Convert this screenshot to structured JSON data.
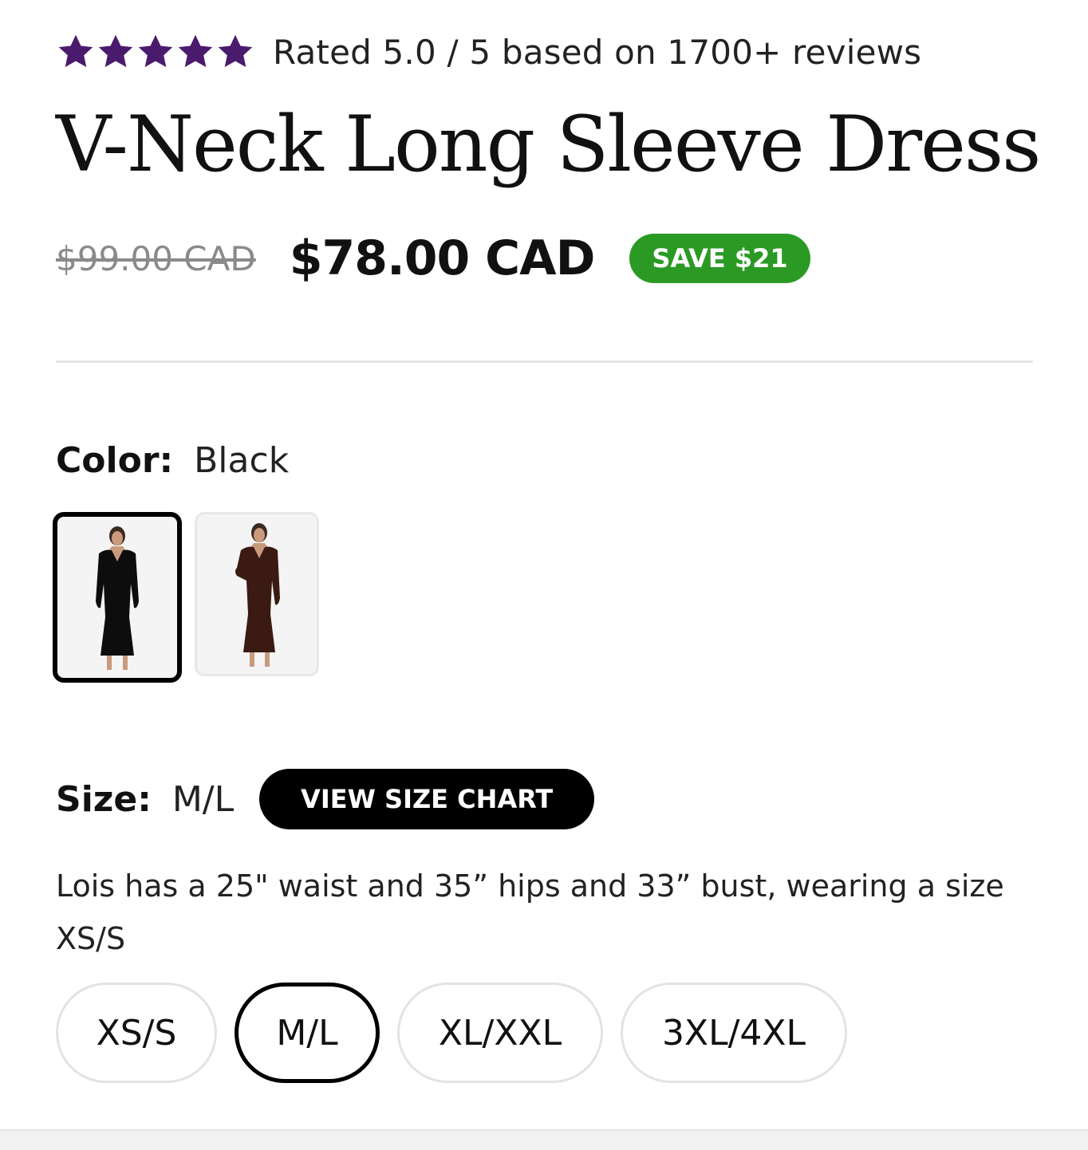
{
  "rating": {
    "stars": 5,
    "star_color": "#4a1b6d",
    "text": "Rated 5.0 / 5 based on 1700+ reviews"
  },
  "product": {
    "title": "V-Neck Long Sleeve Dress"
  },
  "price": {
    "original": "$99.00 CAD",
    "current": "$78.00 CAD",
    "save_badge": "SAVE $21",
    "badge_color": "#2a9a25"
  },
  "color": {
    "label": "Color:",
    "value": "Black",
    "swatches": [
      {
        "name": "Black",
        "color": "#111111",
        "selected": true
      },
      {
        "name": "Brown",
        "color": "#3a1a12",
        "selected": false
      }
    ]
  },
  "size": {
    "label": "Size:",
    "value": "M/L",
    "chart_button": "VIEW SIZE CHART",
    "model_note": "Lois has a 25\" waist and 35” hips and 33” bust, wearing a size XS/S",
    "options": [
      "XS/S",
      "M/L",
      "XL/XXL",
      "3XL/4XL"
    ],
    "selected": "M/L"
  }
}
